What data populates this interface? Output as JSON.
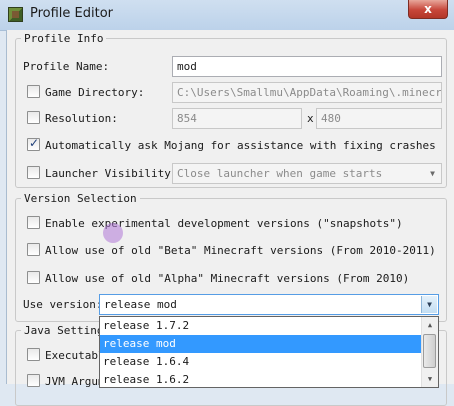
{
  "window": {
    "title": "Profile Editor",
    "close_label": "x"
  },
  "profile_info": {
    "legend": "Profile Info",
    "profile_name_label": "Profile Name:",
    "profile_name_value": "mod",
    "game_directory_label": "Game Directory:",
    "game_directory_value": "C:\\Users\\Smallmu\\AppData\\Roaming\\.minecraft",
    "game_directory_checked": false,
    "resolution_label": "Resolution:",
    "resolution_width": "854",
    "resolution_separator": "x",
    "resolution_height": "480",
    "resolution_checked": false,
    "auto_crash_label": "Automatically ask Mojang for assistance with fixing crashes",
    "auto_crash_checked": true,
    "launcher_visibility_label": "Launcher Visibility:",
    "launcher_visibility_value": "Close launcher when game starts",
    "launcher_visibility_checked": false
  },
  "version_selection": {
    "legend": "Version Selection",
    "snapshots_label": "Enable experimental development versions (\"snapshots\")",
    "beta_label": "Allow use of old \"Beta\" Minecraft versions (From 2010-2011)",
    "alpha_label": "Allow use of old \"Alpha\" Minecraft versions (From 2010)",
    "use_version_label": "Use version:",
    "use_version_value": "release mod",
    "options": [
      "release 1.7.2",
      "release mod",
      "release 1.6.4",
      "release 1.6.2"
    ],
    "selected_index": 1
  },
  "java_settings": {
    "legend": "Java Settings",
    "executable_label": "Executable",
    "jvm_label": "JVM Argume"
  },
  "colors": {
    "selection": "#3399ff",
    "titlebar": "#bcd2ea",
    "close_button": "#c7463a"
  }
}
